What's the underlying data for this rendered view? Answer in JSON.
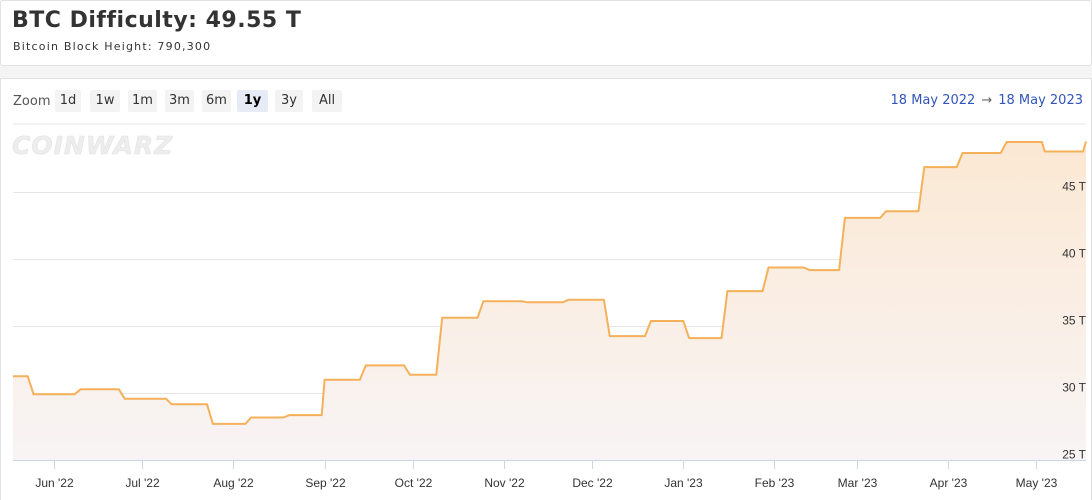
{
  "header": {
    "title": "BTC Difficulty: 49.55 T",
    "subtitle": "Bitcoin Block Height: 790,300"
  },
  "zoom": {
    "label": "Zoom",
    "buttons": [
      "1d",
      "1w",
      "1m",
      "3m",
      "6m",
      "1y",
      "3y",
      "All"
    ],
    "active": "1y"
  },
  "range": {
    "from": "18 May 2022",
    "arrow": "→",
    "to": "18 May 2023"
  },
  "watermark": "COINWARZ",
  "colors": {
    "line": "#f5b05a",
    "fill_top": "#fbe8d3",
    "fill_bottom": "#f8f4f5",
    "grid": "#e6e6e6",
    "range_text": "#3355bb",
    "active_zoom": "#e6ebf5"
  },
  "chart_data": {
    "type": "line",
    "title": "",
    "xlabel": "",
    "ylabel": "",
    "x_ticks": [
      "Jun '22",
      "Jul '22",
      "Aug '22",
      "Sep '22",
      "Oct '22",
      "Nov '22",
      "Dec '22",
      "Jan '23",
      "Feb '23",
      "Mar '23",
      "Apr '23",
      "May '23"
    ],
    "y_ticks": [
      "25 T",
      "30 T",
      "35 T",
      "40 T",
      "45 T"
    ],
    "ylim": [
      25,
      50.05
    ],
    "xlim": [
      "2022-05-18",
      "2023-05-18"
    ],
    "grid": true,
    "legend": "none",
    "series": [
      {
        "unit": "T",
        "points": [
          [
            "2022-05-18",
            31.25
          ],
          [
            "2022-05-23",
            31.25
          ],
          [
            "2022-05-25",
            29.9
          ],
          [
            "2022-06-08",
            29.9
          ],
          [
            "2022-06-10",
            30.28
          ],
          [
            "2022-06-23",
            30.28
          ],
          [
            "2022-06-25",
            29.57
          ],
          [
            "2022-07-09",
            29.57
          ],
          [
            "2022-07-11",
            29.15
          ],
          [
            "2022-07-23",
            29.15
          ],
          [
            "2022-07-25",
            27.69
          ],
          [
            "2022-08-05",
            27.69
          ],
          [
            "2022-08-07",
            28.17
          ],
          [
            "2022-08-18",
            28.17
          ],
          [
            "2022-08-20",
            28.35
          ],
          [
            "2022-08-31",
            28.35
          ],
          [
            "2022-09-01",
            30.98
          ],
          [
            "2022-09-13",
            30.98
          ],
          [
            "2022-09-15",
            32.05
          ],
          [
            "2022-09-28",
            32.05
          ],
          [
            "2022-09-30",
            31.36
          ],
          [
            "2022-10-09",
            31.36
          ],
          [
            "2022-10-11",
            35.61
          ],
          [
            "2022-10-23",
            35.61
          ],
          [
            "2022-10-25",
            36.84
          ],
          [
            "2022-11-07",
            36.84
          ],
          [
            "2022-11-09",
            36.76
          ],
          [
            "2022-11-21",
            36.76
          ],
          [
            "2022-11-23",
            36.95
          ],
          [
            "2022-12-05",
            36.95
          ],
          [
            "2022-12-07",
            34.24
          ],
          [
            "2022-12-19",
            34.24
          ],
          [
            "2022-12-21",
            35.36
          ],
          [
            "2023-01-01",
            35.36
          ],
          [
            "2023-01-03",
            34.09
          ],
          [
            "2023-01-14",
            34.09
          ],
          [
            "2023-01-16",
            37.59
          ],
          [
            "2023-01-28",
            37.59
          ],
          [
            "2023-01-30",
            39.35
          ],
          [
            "2023-02-11",
            39.35
          ],
          [
            "2023-02-13",
            39.16
          ],
          [
            "2023-02-23",
            39.16
          ],
          [
            "2023-02-25",
            43.05
          ],
          [
            "2023-03-09",
            43.05
          ],
          [
            "2023-03-11",
            43.55
          ],
          [
            "2023-03-22",
            43.55
          ],
          [
            "2023-03-24",
            46.84
          ],
          [
            "2023-04-04",
            46.84
          ],
          [
            "2023-04-06",
            47.89
          ],
          [
            "2023-04-19",
            47.89
          ],
          [
            "2023-04-21",
            48.71
          ],
          [
            "2023-05-03",
            48.71
          ],
          [
            "2023-05-04",
            48.0
          ],
          [
            "2023-05-17",
            48.0
          ],
          [
            "2023-05-18",
            48.75
          ]
        ]
      }
    ]
  }
}
